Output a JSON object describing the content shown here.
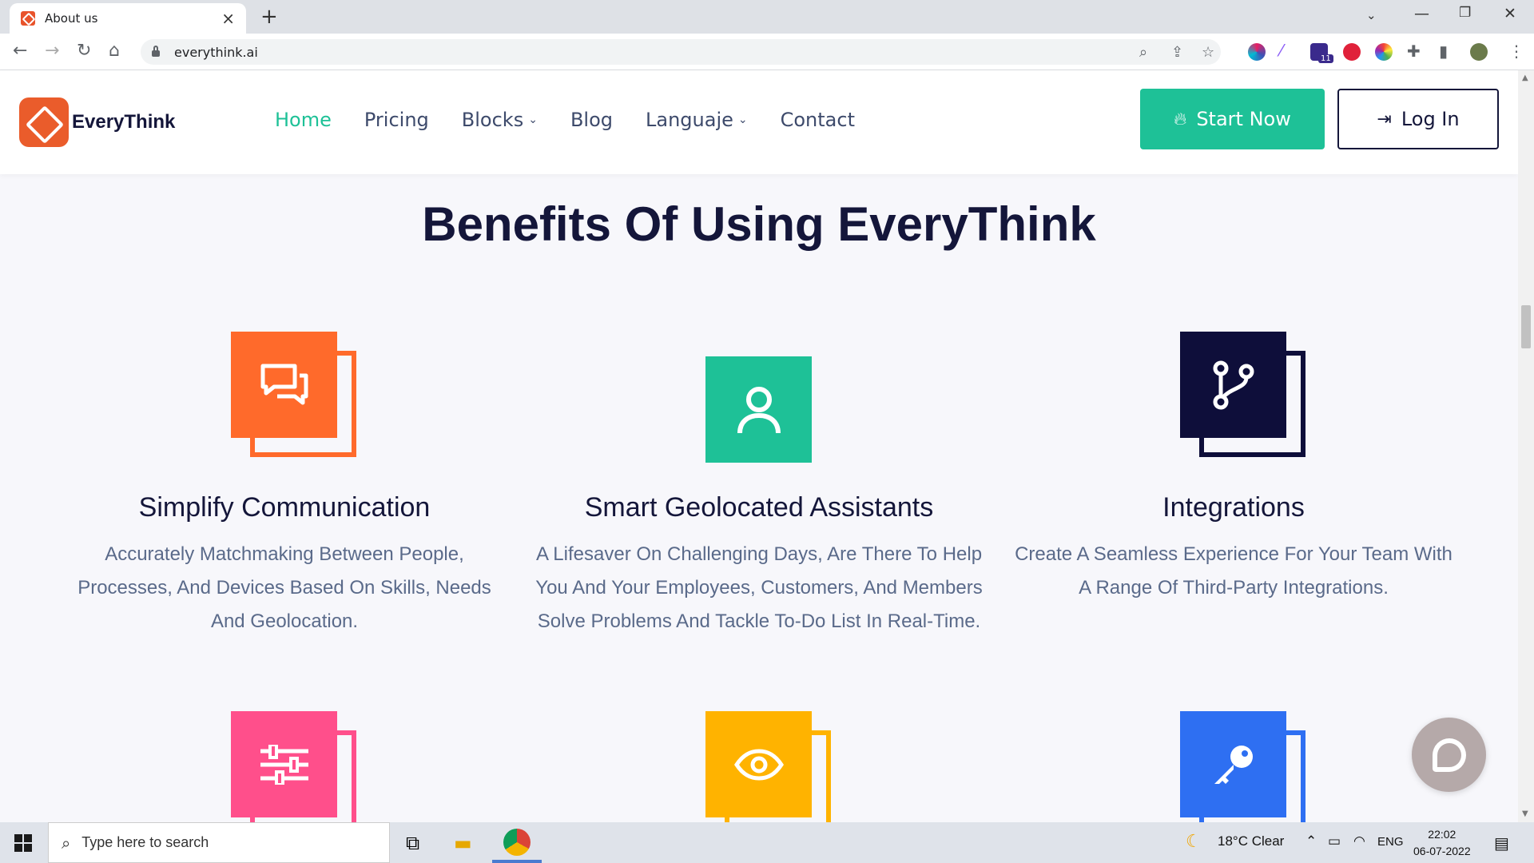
{
  "browser": {
    "tab_title": "About us",
    "url": "everythink.ai",
    "badge_count": "11"
  },
  "site": {
    "logo_text": "EveryThink",
    "nav": [
      {
        "label": "Home",
        "active": true
      },
      {
        "label": "Pricing"
      },
      {
        "label": "Blocks",
        "dropdown": true
      },
      {
        "label": "Blog"
      },
      {
        "label": "Languaje",
        "dropdown": true
      },
      {
        "label": "Contact"
      }
    ],
    "start_label": "Start Now",
    "login_label": "Log In"
  },
  "content": {
    "title": "Benefits Of Using EveryThink",
    "features": [
      {
        "title": "Simplify Communication",
        "desc": "Accurately Matchmaking Between People, Processes, And Devices Based On Skills, Needs And Geolocation.",
        "color": "#ff6a2b",
        "icon": "chat-bubbles-icon"
      },
      {
        "title": "Smart Geolocated Assistants",
        "desc": "A Lifesaver On Challenging Days, Are There To Help You And Your Employees, Customers, And Members Solve Problems And Tackle To-Do List In Real-Time.",
        "color": "#1ec197",
        "icon": "user-icon"
      },
      {
        "title": "Integrations",
        "desc": "Create A Seamless Experience For Your Team With A Range Of Third-Party Integrations.",
        "color": "#0e0e3a",
        "icon": "git-branch-icon"
      },
      {
        "color": "#ff4f8b",
        "icon": "sliders-icon"
      },
      {
        "color": "#ffb300",
        "icon": "eye-icon"
      },
      {
        "color": "#2e6ff2",
        "icon": "key-icon"
      }
    ]
  },
  "taskbar": {
    "search_placeholder": "Type here to search",
    "weather": "18°C  Clear",
    "lang": "ENG",
    "time": "22:02",
    "date": "06-07-2022"
  }
}
